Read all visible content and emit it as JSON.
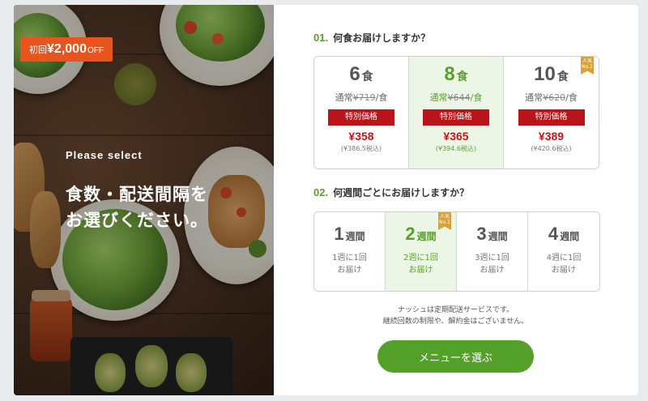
{
  "promo": {
    "prefix": "初回",
    "amount": "¥2,000",
    "suffix": "OFF"
  },
  "hero": {
    "subtitle": "Please select",
    "title": "食数・配送間隔を\nお選びください。"
  },
  "meals_section": {
    "number": "01.",
    "title": "何食お届けしますか？",
    "options": [
      {
        "count": "6",
        "unit": "食",
        "normal_prefix": "通常",
        "normal_price": "¥719",
        "normal_suffix": "/食",
        "badge": "特別価格",
        "price": "¥358",
        "tax": "(¥386.5税込)",
        "selected": false,
        "popular": false
      },
      {
        "count": "8",
        "unit": "食",
        "normal_prefix": "通常",
        "normal_price": "¥644",
        "normal_suffix": "/食",
        "badge": "特別価格",
        "price": "¥365",
        "tax": "(¥394.6税込)",
        "selected": true,
        "popular": false
      },
      {
        "count": "10",
        "unit": "食",
        "normal_prefix": "通常",
        "normal_price": "¥620",
        "normal_suffix": "/食",
        "badge": "特別価格",
        "price": "¥389",
        "tax": "(¥420.6税込)",
        "selected": false,
        "popular": true,
        "popular_label": "人気No.1"
      }
    ]
  },
  "weeks_section": {
    "number": "02.",
    "title": "何週間ごとにお届けしますか？",
    "options": [
      {
        "count": "1",
        "unit": "週間",
        "desc": "1週に1回\nお届け",
        "selected": false,
        "popular": false
      },
      {
        "count": "2",
        "unit": "週間",
        "desc": "2週に1回\nお届け",
        "selected": true,
        "popular": true,
        "popular_label": "人気No.1"
      },
      {
        "count": "3",
        "unit": "週間",
        "desc": "3週に1回\nお届け",
        "selected": false,
        "popular": false
      },
      {
        "count": "4",
        "unit": "週間",
        "desc": "4週に1回\nお届け",
        "selected": false,
        "popular": false
      }
    ]
  },
  "note": "ナッシュは定期配送サービスです。\n継続回数の制限や、解約金はございません。",
  "cta": {
    "label": "メニューを選ぶ"
  },
  "colors": {
    "accent": "#53a12b",
    "selected_bg": "#ecf6e6",
    "price_red": "#c5151b",
    "badge_red": "#b8141a",
    "promo_orange": "#e8541c",
    "ribbon_gold": "#d9a13a"
  }
}
